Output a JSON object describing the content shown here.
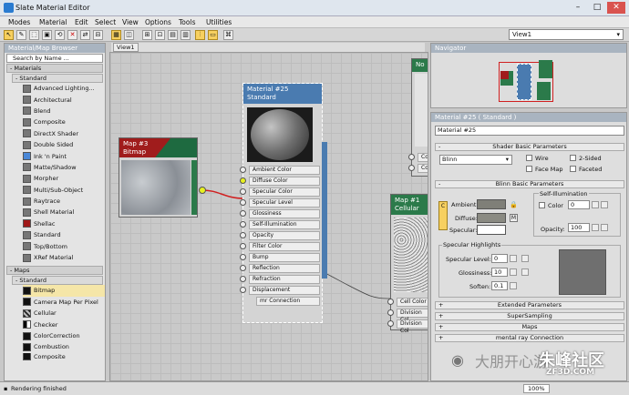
{
  "window": {
    "title": "Slate Material Editor"
  },
  "menu": [
    "Modes",
    "Material",
    "Edit",
    "Select",
    "View",
    "Options",
    "Tools",
    "Utilities"
  ],
  "toolbar": {
    "view_select": "View1"
  },
  "browser": {
    "title": "Material/Map Browser",
    "search_placeholder": "Search by Name ...",
    "materials_group": "Materials",
    "standard_group": "Standard",
    "materials": [
      "Advanced Lighting...",
      "Architectural",
      "Blend",
      "Composite",
      "DirectX Shader",
      "Double Sided",
      "Ink 'n Paint",
      "Matte/Shadow",
      "Morpher",
      "Multi/Sub-Object",
      "Raytrace",
      "Shell Material",
      "Shellac",
      "Standard",
      "Top/Bottom",
      "XRef Material"
    ],
    "maps_group": "Maps",
    "maps_standard_group": "Standard",
    "maps": [
      "Bitmap",
      "Camera Map Per Pixel",
      "Cellular",
      "Checker",
      "ColorCorrection",
      "Combustion",
      "Composite"
    ]
  },
  "view": {
    "tab": "View1"
  },
  "nodes": {
    "bitmap": {
      "title": "Map #3",
      "subtitle": "Bitmap"
    },
    "material": {
      "title": "Material #25",
      "subtitle": "Standard",
      "slots": [
        "Ambient Color",
        "Diffuse Color",
        "Specular Color",
        "Specular Level",
        "Glossiness",
        "Self-Illumination",
        "Opacity",
        "Filter Color",
        "Bump",
        "Reflection",
        "Refraction",
        "Displacement",
        "mr Connection"
      ]
    },
    "cellular": {
      "title": "Map #1",
      "subtitle": "Cellular",
      "slots": [
        "Cell Color",
        "Division Col",
        "Division Col"
      ]
    },
    "noise": {
      "title": "No",
      "slots": [
        "Co",
        "Co"
      ]
    }
  },
  "navigator": {
    "title": "Navigator"
  },
  "params": {
    "header": "Material #25 ( Standard )",
    "name_value": "Material #25",
    "shader_rollout": "Shader Basic Parameters",
    "shader_value": "Blinn",
    "checks": [
      "Wire",
      "2-Sided",
      "Face Map",
      "Faceted"
    ],
    "blinn_rollout": "Blinn Basic Parameters",
    "self_illum_label": "Self-Illumination",
    "ambient_label": "Ambient:",
    "diffuse_label": "Diffuse:",
    "specular_label": "Specular:",
    "color_label": "Color",
    "color_value": "0",
    "opacity_label": "Opacity:",
    "opacity_value": "100",
    "m_label": "M",
    "c_label": "C",
    "highlights_label": "Specular Highlights",
    "spec_level_label": "Specular Level:",
    "spec_level_value": "0",
    "glossiness_label": "Glossiness:",
    "glossiness_value": "10",
    "soften_label": "Soften:",
    "soften_value": "0.1",
    "rollouts": [
      "Extended Parameters",
      "SuperSampling",
      "Maps",
      "mental ray Connection"
    ]
  },
  "status": {
    "text": "Rendering finished",
    "zoom": "100%"
  },
  "watermark": {
    "text1": "大朋开心游",
    "text2": "朱峰社区",
    "text3": "ZF3D.COM"
  },
  "colors": {
    "selection": "#f7d060",
    "node_material": "#4a7bb0",
    "node_bitmap": "#1e6a40",
    "node_cellular": "#2b7a4a",
    "bitmap_tag": "#c02020"
  }
}
